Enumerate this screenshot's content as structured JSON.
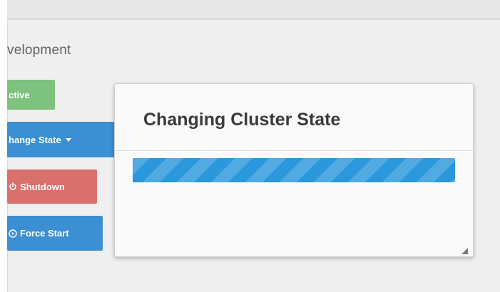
{
  "background_panel": {
    "env_title": "velopment",
    "buttons": {
      "status_label": "ctive",
      "change_state_label": "hange State",
      "shutdown_label": "Shutdown",
      "force_start_label": "Force Start"
    }
  },
  "modal": {
    "title": "Changing Cluster State",
    "progress": 1.0
  },
  "colors": {
    "active_green": "#7dc27e",
    "primary_blue": "#3c8fd3",
    "danger_red": "#d9706c",
    "progress_blue": "#2b98dc"
  },
  "icons": {
    "change_state": "caret-down-icon",
    "shutdown": "power-icon",
    "force_start": "play-circle-icon",
    "modal_corner": "resize-grip-icon"
  }
}
